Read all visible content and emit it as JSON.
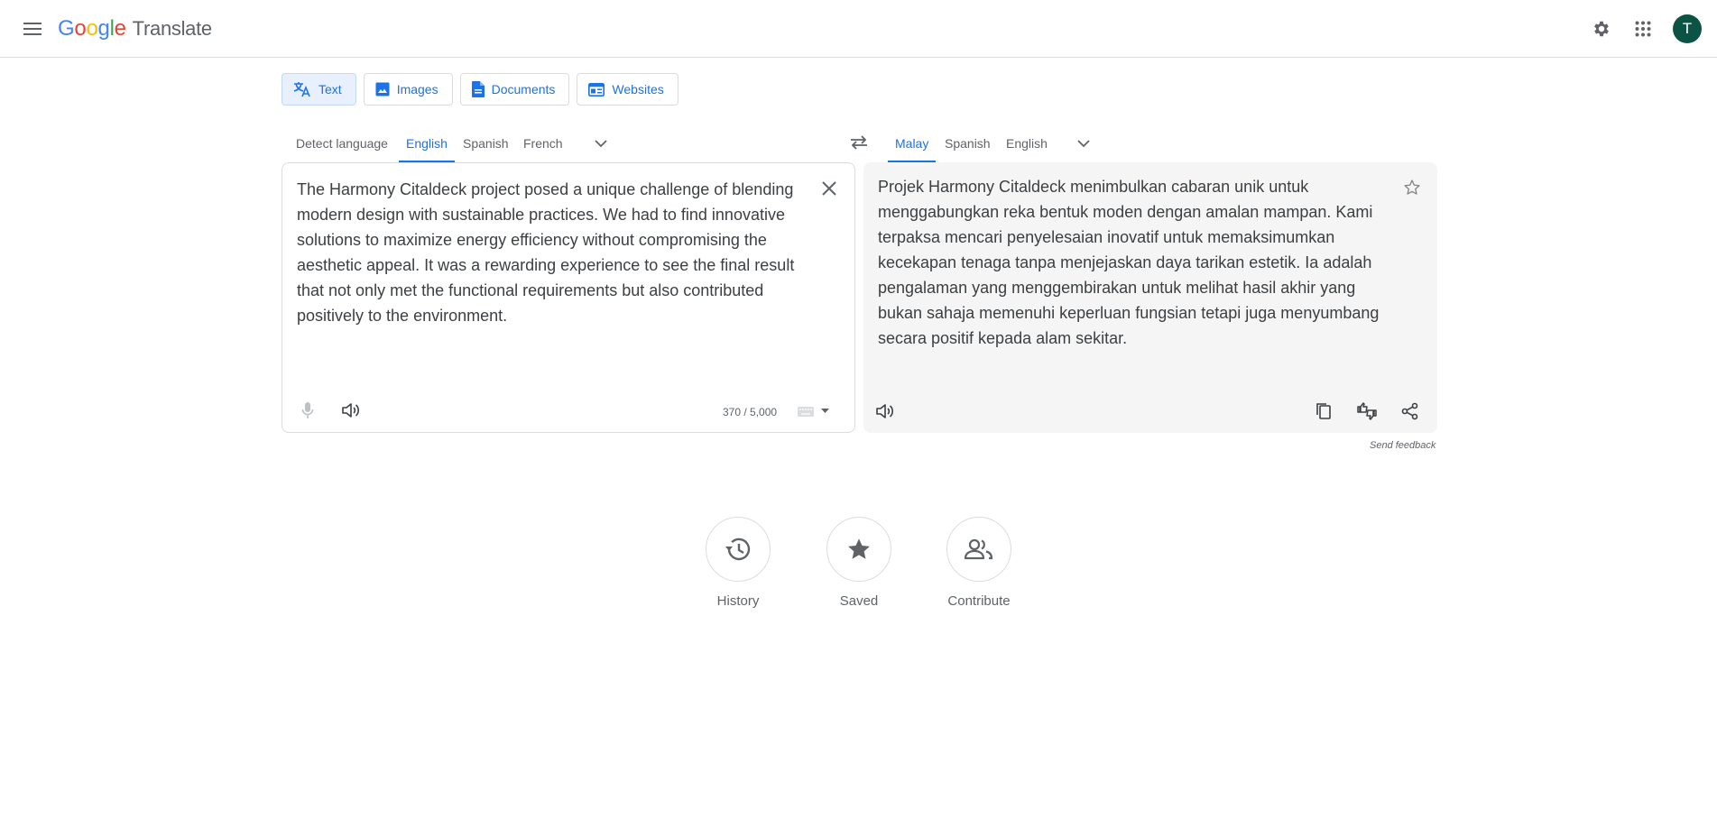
{
  "header": {
    "logo": {
      "google_letters": [
        "G",
        "o",
        "o",
        "g",
        "l",
        "e"
      ],
      "product": "Translate"
    },
    "avatar_initial": "T",
    "icons": [
      "menu-icon",
      "settings-icon",
      "apps-grid-icon"
    ]
  },
  "modes": [
    {
      "label": "Text",
      "icon": "translate-icon",
      "active": true
    },
    {
      "label": "Images",
      "icon": "image-icon",
      "active": false
    },
    {
      "label": "Documents",
      "icon": "document-icon",
      "active": false
    },
    {
      "label": "Websites",
      "icon": "website-icon",
      "active": false
    }
  ],
  "source": {
    "languages": [
      "Detect language",
      "English",
      "Spanish",
      "French"
    ],
    "selected": "English",
    "text": "The Harmony Citaldeck project posed a unique challenge of blending modern design with sustainable practices. We had to find innovative solutions to maximize energy efficiency without compromising the aesthetic appeal. It was a rewarding experience to see the final result that not only met the functional requirements but also contributed positively to the environment.",
    "char_count": "370 / 5,000"
  },
  "target": {
    "languages": [
      "Malay",
      "Spanish",
      "English"
    ],
    "selected": "Malay",
    "text": "Projek Harmony Citaldeck menimbulkan cabaran unik untuk menggabungkan reka bentuk moden dengan amalan mampan. Kami terpaksa mencari penyelesaian inovatif untuk memaksimumkan kecekapan tenaga tanpa menjejaskan daya tarikan estetik. Ia adalah pengalaman yang menggembirakan untuk melihat hasil akhir yang bukan sahaja memenuhi keperluan fungsian tetapi juga menyumbang secara positif kepada alam sekitar."
  },
  "feedback_label": "Send feedback",
  "shortcuts": [
    {
      "label": "History",
      "icon": "history-icon"
    },
    {
      "label": "Saved",
      "icon": "star-icon"
    },
    {
      "label": "Contribute",
      "icon": "people-icon"
    }
  ],
  "colors": {
    "accent": "#1a73e8",
    "google_blue": "#4285f4",
    "google_red": "#ea4335",
    "google_yellow": "#fbbc05",
    "google_green": "#34a853",
    "avatar_bg": "#0b5345",
    "target_panel_bg": "#f5f5f5"
  }
}
